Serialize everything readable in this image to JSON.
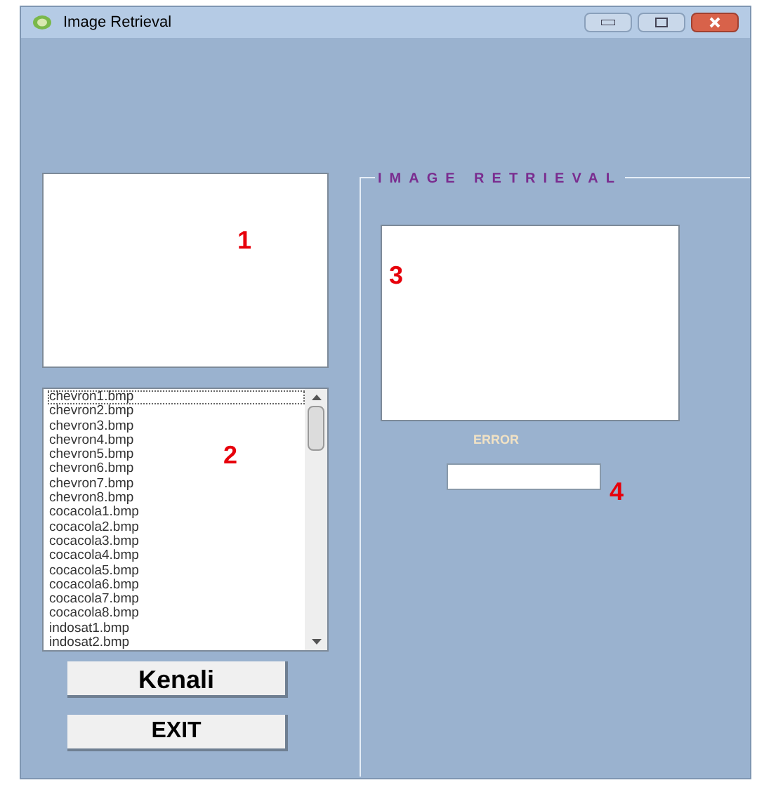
{
  "window": {
    "title": "Image Retrieval"
  },
  "image_box_1": {
    "marker": "1"
  },
  "file_list": {
    "marker": "2",
    "items": [
      {
        "label": "chevron1.bmp",
        "selected": true
      },
      {
        "label": "chevron2.bmp",
        "selected": false
      },
      {
        "label": "chevron3.bmp",
        "selected": false
      },
      {
        "label": "chevron4.bmp",
        "selected": false
      },
      {
        "label": "chevron5.bmp",
        "selected": false
      },
      {
        "label": "chevron6.bmp",
        "selected": false
      },
      {
        "label": "chevron7.bmp",
        "selected": false
      },
      {
        "label": "chevron8.bmp",
        "selected": false
      },
      {
        "label": "cocacola1.bmp",
        "selected": false
      },
      {
        "label": "cocacola2.bmp",
        "selected": false
      },
      {
        "label": "cocacola3.bmp",
        "selected": false
      },
      {
        "label": "cocacola4.bmp",
        "selected": false
      },
      {
        "label": "cocacola5.bmp",
        "selected": false
      },
      {
        "label": "cocacola6.bmp",
        "selected": false
      },
      {
        "label": "cocacola7.bmp",
        "selected": false
      },
      {
        "label": "cocacola8.bmp",
        "selected": false
      },
      {
        "label": "indosat1.bmp",
        "selected": false
      },
      {
        "label": "indosat2.bmp",
        "selected": false
      }
    ]
  },
  "buttons": [
    "Kenali",
    "EXIT"
  ],
  "group": {
    "title": "IMAGE RETRIEVAL",
    "image_box_3": {
      "marker": "3"
    },
    "error_label": "ERROR",
    "error_field": {
      "marker": "4"
    }
  }
}
